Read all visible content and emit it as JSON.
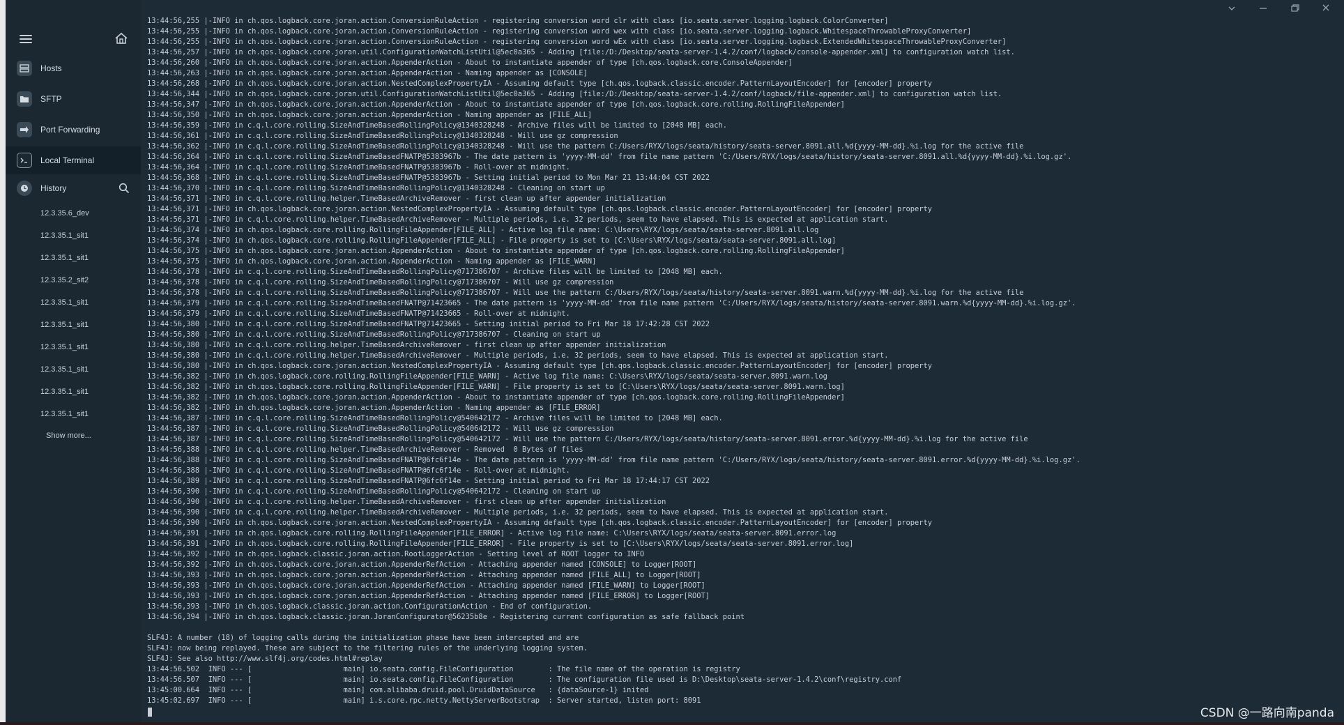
{
  "sidebar": {
    "menu_icon": "hamburger-menu-icon",
    "home_icon": "home-icon",
    "nav": [
      {
        "label": "Hosts",
        "icon": "hosts-icon"
      },
      {
        "label": "SFTP",
        "icon": "folder-icon"
      },
      {
        "label": "Port Forwarding",
        "icon": "port-forwarding-icon"
      },
      {
        "label": "Local Terminal",
        "icon": "terminal-icon"
      }
    ],
    "history": {
      "label": "History",
      "icon": "history-icon",
      "search_icon": "search-icon",
      "items": [
        "12.3.35.6_dev",
        "12.3.35.1_sit1",
        "12.3.35.1_sit1",
        "12.3.35.2_sit2",
        "12.3.35.1_sit1",
        "12.3.35.1_sit1",
        "12.3.35.1_sit1",
        "12.3.35.1_sit1",
        "12.3.35.1_sit1",
        "12.3.35.1_sit1"
      ],
      "show_more": "Show more..."
    }
  },
  "window_controls": [
    "chevron-down-icon",
    "minimize-icon",
    "restore-icon",
    "close-icon"
  ],
  "terminal": {
    "lines": [
      "13:44:56,255 |-INFO in ch.qos.logback.core.joran.action.ConversionRuleAction - registering conversion word clr with class [io.seata.server.logging.logback.ColorConverter]",
      "13:44:56,255 |-INFO in ch.qos.logback.core.joran.action.ConversionRuleAction - registering conversion word wex with class [io.seata.server.logging.logback.WhitespaceThrowableProxyConverter]",
      "13:44:56,255 |-INFO in ch.qos.logback.core.joran.action.ConversionRuleAction - registering conversion word wEx with class [io.seata.server.logging.logback.ExtendedWhitespaceThrowableProxyConverter]",
      "13:44:56,257 |-INFO in ch.qos.logback.core.joran.util.ConfigurationWatchListUtil@5ec0a365 - Adding [file:/D:/Desktop/seata-server-1.4.2/conf/logback/console-appender.xml] to configuration watch list.",
      "13:44:56,260 |-INFO in ch.qos.logback.core.joran.action.AppenderAction - About to instantiate appender of type [ch.qos.logback.core.ConsoleAppender]",
      "13:44:56,263 |-INFO in ch.qos.logback.core.joran.action.AppenderAction - Naming appender as [CONSOLE]",
      "13:44:56,268 |-INFO in ch.qos.logback.core.joran.action.NestedComplexPropertyIA - Assuming default type [ch.qos.logback.classic.encoder.PatternLayoutEncoder] for [encoder] property",
      "13:44:56,344 |-INFO in ch.qos.logback.core.joran.util.ConfigurationWatchListUtil@5ec0a365 - Adding [file:/D:/Desktop/seata-server-1.4.2/conf/logback/file-appender.xml] to configuration watch list.",
      "13:44:56,347 |-INFO in ch.qos.logback.core.joran.action.AppenderAction - About to instantiate appender of type [ch.qos.logback.core.rolling.RollingFileAppender]",
      "13:44:56,350 |-INFO in ch.qos.logback.core.joran.action.AppenderAction - Naming appender as [FILE_ALL]",
      "13:44:56,359 |-INFO in c.q.l.core.rolling.SizeAndTimeBasedRollingPolicy@1340328248 - Archive files will be limited to [2048 MB] each.",
      "13:44:56,361 |-INFO in c.q.l.core.rolling.SizeAndTimeBasedRollingPolicy@1340328248 - Will use gz compression",
      "13:44:56,362 |-INFO in c.q.l.core.rolling.SizeAndTimeBasedRollingPolicy@1340328248 - Will use the pattern C:/Users/RYX/logs/seata/history/seata-server.8091.all.%d{yyyy-MM-dd}.%i.log for the active file",
      "13:44:56,364 |-INFO in c.q.l.core.rolling.SizeAndTimeBasedFNATP@5383967b - The date pattern is 'yyyy-MM-dd' from file name pattern 'C:/Users/RYX/logs/seata/history/seata-server.8091.all.%d{yyyy-MM-dd}.%i.log.gz'.",
      "13:44:56,364 |-INFO in c.q.l.core.rolling.SizeAndTimeBasedFNATP@5383967b - Roll-over at midnight.",
      "13:44:56,368 |-INFO in c.q.l.core.rolling.SizeAndTimeBasedFNATP@5383967b - Setting initial period to Mon Mar 21 13:44:04 CST 2022",
      "13:44:56,370 |-INFO in c.q.l.core.rolling.SizeAndTimeBasedRollingPolicy@1340328248 - Cleaning on start up",
      "13:44:56,371 |-INFO in c.q.l.core.rolling.helper.TimeBasedArchiveRemover - first clean up after appender initialization",
      "13:44:56,371 |-INFO in ch.qos.logback.core.joran.action.NestedComplexPropertyIA - Assuming default type [ch.qos.logback.classic.encoder.PatternLayoutEncoder] for [encoder] property",
      "13:44:56,371 |-INFO in c.q.l.core.rolling.helper.TimeBasedArchiveRemover - Multiple periods, i.e. 32 periods, seem to have elapsed. This is expected at application start.",
      "13:44:56,374 |-INFO in ch.qos.logback.core.rolling.RollingFileAppender[FILE_ALL] - Active log file name: C:\\Users\\RYX/logs/seata/seata-server.8091.all.log",
      "13:44:56,374 |-INFO in ch.qos.logback.core.rolling.RollingFileAppender[FILE_ALL] - File property is set to [C:\\Users\\RYX/logs/seata/seata-server.8091.all.log]",
      "13:44:56,375 |-INFO in ch.qos.logback.core.joran.action.AppenderAction - About to instantiate appender of type [ch.qos.logback.core.rolling.RollingFileAppender]",
      "13:44:56,375 |-INFO in ch.qos.logback.core.joran.action.AppenderAction - Naming appender as [FILE_WARN]",
      "13:44:56,378 |-INFO in c.q.l.core.rolling.SizeAndTimeBasedRollingPolicy@717386707 - Archive files will be limited to [2048 MB] each.",
      "13:44:56,378 |-INFO in c.q.l.core.rolling.SizeAndTimeBasedRollingPolicy@717386707 - Will use gz compression",
      "13:44:56,378 |-INFO in c.q.l.core.rolling.SizeAndTimeBasedRollingPolicy@717386707 - Will use the pattern C:/Users/RYX/logs/seata/history/seata-server.8091.warn.%d{yyyy-MM-dd}.%i.log for the active file",
      "13:44:56,379 |-INFO in c.q.l.core.rolling.SizeAndTimeBasedFNATP@71423665 - The date pattern is 'yyyy-MM-dd' from file name pattern 'C:/Users/RYX/logs/seata/history/seata-server.8091.warn.%d{yyyy-MM-dd}.%i.log.gz'.",
      "13:44:56,379 |-INFO in c.q.l.core.rolling.SizeAndTimeBasedFNATP@71423665 - Roll-over at midnight.",
      "13:44:56,380 |-INFO in c.q.l.core.rolling.SizeAndTimeBasedFNATP@71423665 - Setting initial period to Fri Mar 18 17:42:28 CST 2022",
      "13:44:56,380 |-INFO in c.q.l.core.rolling.SizeAndTimeBasedRollingPolicy@717386707 - Cleaning on start up",
      "13:44:56,380 |-INFO in c.q.l.core.rolling.helper.TimeBasedArchiveRemover - first clean up after appender initialization",
      "13:44:56,380 |-INFO in c.q.l.core.rolling.helper.TimeBasedArchiveRemover - Multiple periods, i.e. 32 periods, seem to have elapsed. This is expected at application start.",
      "13:44:56,380 |-INFO in ch.qos.logback.core.joran.action.NestedComplexPropertyIA - Assuming default type [ch.qos.logback.classic.encoder.PatternLayoutEncoder] for [encoder] property",
      "13:44:56,382 |-INFO in ch.qos.logback.core.rolling.RollingFileAppender[FILE_WARN] - Active log file name: C:\\Users\\RYX/logs/seata/seata-server.8091.warn.log",
      "13:44:56,382 |-INFO in ch.qos.logback.core.rolling.RollingFileAppender[FILE_WARN] - File property is set to [C:\\Users\\RYX/logs/seata/seata-server.8091.warn.log]",
      "13:44:56,382 |-INFO in ch.qos.logback.core.joran.action.AppenderAction - About to instantiate appender of type [ch.qos.logback.core.rolling.RollingFileAppender]",
      "13:44:56,382 |-INFO in ch.qos.logback.core.joran.action.AppenderAction - Naming appender as [FILE_ERROR]",
      "13:44:56,387 |-INFO in c.q.l.core.rolling.SizeAndTimeBasedRollingPolicy@540642172 - Archive files will be limited to [2048 MB] each.",
      "13:44:56,387 |-INFO in c.q.l.core.rolling.SizeAndTimeBasedRollingPolicy@540642172 - Will use gz compression",
      "13:44:56,387 |-INFO in c.q.l.core.rolling.SizeAndTimeBasedRollingPolicy@540642172 - Will use the pattern C:/Users/RYX/logs/seata/history/seata-server.8091.error.%d{yyyy-MM-dd}.%i.log for the active file",
      "13:44:56,388 |-INFO in c.q.l.core.rolling.helper.TimeBasedArchiveRemover - Removed  0 Bytes of files",
      "13:44:56,388 |-INFO in c.q.l.core.rolling.SizeAndTimeBasedFNATP@6fc6f14e - The date pattern is 'yyyy-MM-dd' from file name pattern 'C:/Users/RYX/logs/seata/history/seata-server.8091.error.%d{yyyy-MM-dd}.%i.log.gz'.",
      "13:44:56,388 |-INFO in c.q.l.core.rolling.SizeAndTimeBasedFNATP@6fc6f14e - Roll-over at midnight.",
      "13:44:56,389 |-INFO in c.q.l.core.rolling.SizeAndTimeBasedFNATP@6fc6f14e - Setting initial period to Fri Mar 18 17:44:17 CST 2022",
      "13:44:56,390 |-INFO in c.q.l.core.rolling.SizeAndTimeBasedRollingPolicy@540642172 - Cleaning on start up",
      "13:44:56,390 |-INFO in c.q.l.core.rolling.helper.TimeBasedArchiveRemover - first clean up after appender initialization",
      "13:44:56,390 |-INFO in c.q.l.core.rolling.helper.TimeBasedArchiveRemover - Multiple periods, i.e. 32 periods, seem to have elapsed. This is expected at application start.",
      "13:44:56,390 |-INFO in ch.qos.logback.core.joran.action.NestedComplexPropertyIA - Assuming default type [ch.qos.logback.classic.encoder.PatternLayoutEncoder] for [encoder] property",
      "13:44:56,391 |-INFO in ch.qos.logback.core.rolling.RollingFileAppender[FILE_ERROR] - Active log file name: C:\\Users\\RYX/logs/seata/seata-server.8091.error.log",
      "13:44:56,391 |-INFO in ch.qos.logback.core.rolling.RollingFileAppender[FILE_ERROR] - File property is set to [C:\\Users\\RYX/logs/seata/seata-server.8091.error.log]",
      "13:44:56,392 |-INFO in ch.qos.logback.classic.joran.action.RootLoggerAction - Setting level of ROOT logger to INFO",
      "13:44:56,392 |-INFO in ch.qos.logback.core.joran.action.AppenderRefAction - Attaching appender named [CONSOLE] to Logger[ROOT]",
      "13:44:56,393 |-INFO in ch.qos.logback.core.joran.action.AppenderRefAction - Attaching appender named [FILE_ALL] to Logger[ROOT]",
      "13:44:56,393 |-INFO in ch.qos.logback.core.joran.action.AppenderRefAction - Attaching appender named [FILE_WARN] to Logger[ROOT]",
      "13:44:56,393 |-INFO in ch.qos.logback.core.joran.action.AppenderRefAction - Attaching appender named [FILE_ERROR] to Logger[ROOT]",
      "13:44:56,393 |-INFO in ch.qos.logback.classic.joran.action.ConfigurationAction - End of configuration.",
      "13:44:56,394 |-INFO in ch.qos.logback.classic.joran.JoranConfigurator@56235b8e - Registering current configuration as safe fallback point",
      "",
      "SLF4J: A number (18) of logging calls during the initialization phase have been intercepted and are",
      "SLF4J: now being replayed. These are subject to the filtering rules of the underlying logging system.",
      "SLF4J: See also http://www.slf4j.org/codes.html#replay",
      "13:44:56.502  INFO --- [                     main] io.seata.config.FileConfiguration        : The file name of the operation is registry",
      "13:44:56.507  INFO --- [                     main] io.seata.config.FileConfiguration        : The configuration file used is D:\\Desktop\\seata-server-1.4.2\\conf\\registry.conf",
      "13:45:00.664  INFO --- [                     main] com.alibaba.druid.pool.DruidDataSource   : {dataSource-1} inited",
      "13:45:02.697  INFO --- [                     main] i.s.core.rpc.netty.NettyServerBootstrap  : Server started, listen port: 8091"
    ]
  },
  "watermark": "CSDN @一路向南panda"
}
